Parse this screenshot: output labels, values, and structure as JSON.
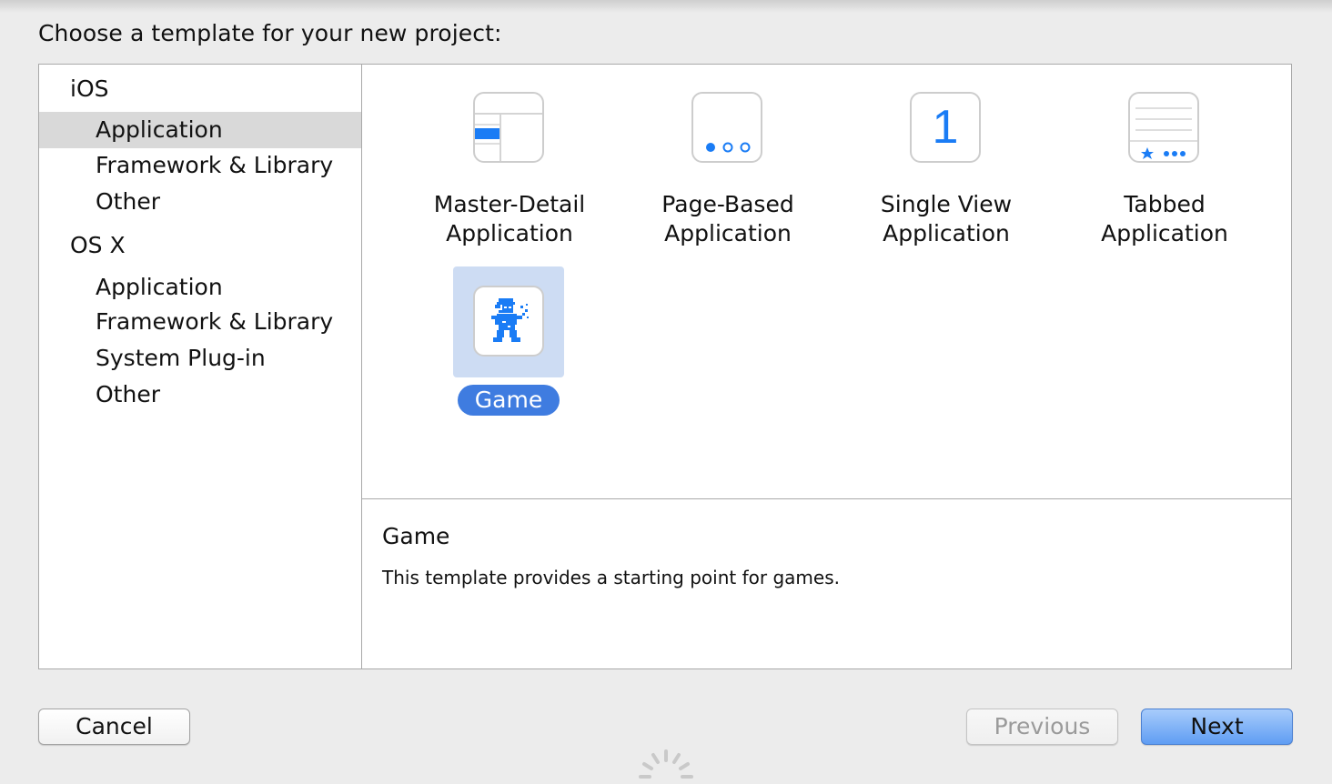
{
  "heading": "Choose a template for your new project:",
  "sidebar": {
    "groups": [
      {
        "label": "iOS",
        "items": [
          {
            "label": "Application",
            "selected": true
          },
          {
            "label": "Framework & Library"
          },
          {
            "label": "Other"
          }
        ]
      },
      {
        "label": "OS X",
        "items": [
          {
            "label": "Application"
          },
          {
            "label": "Framework & Library"
          },
          {
            "label": "System Plug-in"
          },
          {
            "label": "Other"
          }
        ]
      }
    ]
  },
  "templates": [
    {
      "line1": "Master-Detail",
      "line2": "Application",
      "icon": "master-detail-icon"
    },
    {
      "line1": "Page-Based",
      "line2": "Application",
      "icon": "page-based-icon"
    },
    {
      "line1": "Single View",
      "line2": "Application",
      "icon": "single-view-icon",
      "glyph": "1"
    },
    {
      "line1": "Tabbed",
      "line2": "Application",
      "icon": "tabbed-icon"
    },
    {
      "line1": "Game",
      "icon": "game-icon",
      "selected": true
    }
  ],
  "description": {
    "title": "Game",
    "text": "This template provides a starting point for games."
  },
  "buttons": {
    "cancel": "Cancel",
    "previous": "Previous",
    "next": "Next"
  },
  "colors": {
    "accent": "#3f7ce0",
    "icon_blue": "#1a7cf5",
    "selection_bg": "#cddcf3",
    "sidebar_selection": "#d9d9d9"
  }
}
